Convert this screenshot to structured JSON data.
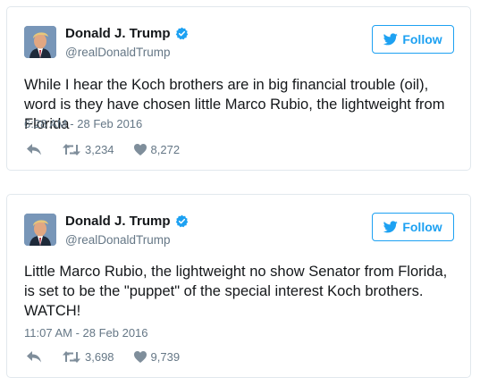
{
  "tweets": [
    {
      "author_name": "Donald J. Trump",
      "handle": "@realDonaldTrump",
      "follow_label": "Follow",
      "text": "While I hear the Koch brothers are in big financial trouble (oil), word is they have chosen little Marco Rubio, the lightweight from Florida",
      "timestamp": "6:28 AM - 28 Feb 2016",
      "retweets": "3,234",
      "likes": "8,272"
    },
    {
      "author_name": "Donald J. Trump",
      "handle": "@realDonaldTrump",
      "follow_label": "Follow",
      "text": "Little Marco Rubio, the lightweight no show Senator from Florida, is set to be the \"puppet\" of the special interest Koch brothers. WATCH!",
      "timestamp": "11:07 AM - 28 Feb 2016",
      "retweets": "3,698",
      "likes": "9,739"
    }
  ],
  "colors": {
    "accent": "#1da1f2",
    "muted": "#657786",
    "border": "#e1e8ed",
    "text": "#14171a"
  },
  "icons": [
    "avatar",
    "verified-badge-icon",
    "twitter-bird-icon",
    "reply-icon",
    "retweet-icon",
    "heart-icon"
  ]
}
